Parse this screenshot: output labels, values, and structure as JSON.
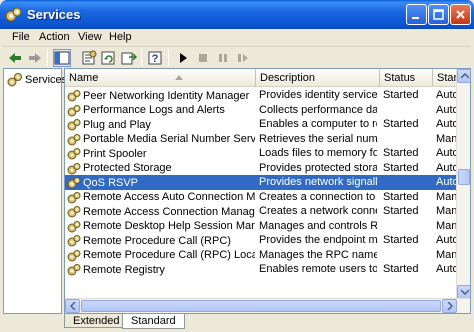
{
  "window": {
    "title": "Services",
    "icon": "services-gear-icon"
  },
  "menu": [
    "File",
    "Action",
    "View",
    "Help"
  ],
  "toolbar": {
    "buttons": [
      "back-arrow-icon",
      "forward-arrow-icon",
      "show-hide-tree-icon",
      "properties-icon",
      "refresh-icon",
      "export-list-icon",
      "help-icon",
      "play-icon",
      "stop-icon",
      "pause-icon",
      "restart-icon"
    ]
  },
  "tree": {
    "root_label": "Services"
  },
  "list": {
    "columns": [
      "Name",
      "Description",
      "Status",
      "Startu"
    ],
    "rows": [
      {
        "name": "Peer Networking Identity Manager",
        "description": "Provides identity service...",
        "status": "Started",
        "startup": "Autom"
      },
      {
        "name": "Performance Logs and Alerts",
        "description": "Collects performance dat...",
        "status": "",
        "startup": "Autom"
      },
      {
        "name": "Plug and Play",
        "description": "Enables a computer to re...",
        "status": "Started",
        "startup": "Autom"
      },
      {
        "name": "Portable Media Serial Number Service",
        "description": "Retrieves the serial num...",
        "status": "",
        "startup": "Manu"
      },
      {
        "name": "Print Spooler",
        "description": "Loads files to memory fo...",
        "status": "Started",
        "startup": "Autom"
      },
      {
        "name": "Protected Storage",
        "description": "Provides protected stora...",
        "status": "Started",
        "startup": "Autom"
      },
      {
        "name": "QoS RSVP",
        "description": "Provides network signall...",
        "status": "",
        "startup": "Autom"
      },
      {
        "name": "Remote Access Auto Connection Manager",
        "description": "Creates a connection to ...",
        "status": "Started",
        "startup": "Manu"
      },
      {
        "name": "Remote Access Connection Manager",
        "description": "Creates a network conne...",
        "status": "Started",
        "startup": "Manu"
      },
      {
        "name": "Remote Desktop Help Session Manager",
        "description": "Manages and controls R...",
        "status": "",
        "startup": "Manu"
      },
      {
        "name": "Remote Procedure Call (RPC)",
        "description": "Provides the endpoint m...",
        "status": "Started",
        "startup": "Autom"
      },
      {
        "name": "Remote Procedure Call (RPC) Locator",
        "description": "Manages the RPC name ...",
        "status": "",
        "startup": "Manu"
      },
      {
        "name": "Remote Registry",
        "description": "Enables remote users to ...",
        "status": "Started",
        "startup": "Autom"
      }
    ],
    "selected_index": 6
  },
  "tabs": [
    "Extended",
    "Standard"
  ],
  "active_tab": "Standard",
  "colors": {
    "titlebar": "#0b52cf",
    "selection": "#316ac5",
    "window_bg": "#ece9d8"
  }
}
